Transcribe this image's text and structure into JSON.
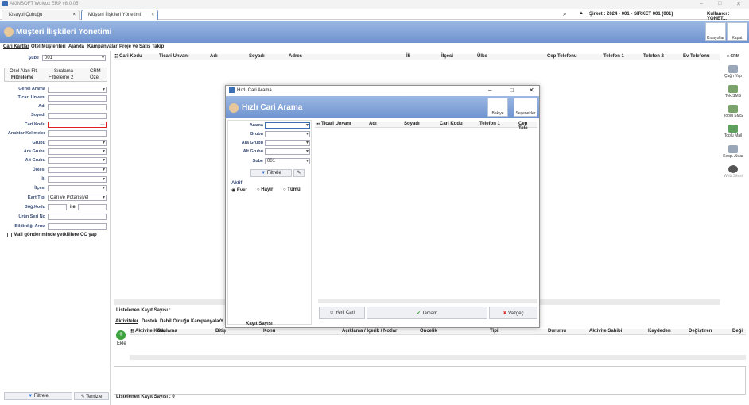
{
  "window": {
    "title": "AKINSOFT Wolvox ERP v8.0.05",
    "buttons": {
      "minimize": "–",
      "maximize": "□",
      "close": "✕"
    }
  },
  "tabs": [
    {
      "label": "Kısayol Çubuğu"
    },
    {
      "label": "Müşteri İlişkileri Yönetimi"
    }
  ],
  "status": {
    "company": "Şirket : 2024 - 001 - SIRKET 001 (001)",
    "user": "Kullanıcı : YONET..."
  },
  "banner": {
    "title": "Müşteri İlişkileri Yönetimi",
    "buttons": [
      {
        "label": "Kısayollar"
      },
      {
        "label": "Kapat"
      }
    ]
  },
  "menu": [
    "Cari Kartlar",
    "Otel Müşterileri",
    "Ajanda",
    "Kampanyalar",
    "Proje ve Satış Takip"
  ],
  "filter": {
    "sube_label": "Şube",
    "sube_value": "001",
    "tabs_row1": [
      "Özel Alan Flt.",
      "Sıralama",
      "CRM"
    ],
    "tabs_row2": [
      "Filtreleme",
      "Filtreleme 2",
      "Özel"
    ],
    "fields": [
      "Genel Arama",
      "Ticari Unvanı",
      "Adı",
      "Soyadı",
      "Cari Kodu",
      "Anahtar Kelimeler",
      "Grubu",
      "Ara Grubu",
      "Alt Grubu",
      "Ülkesi",
      "İli",
      "İlçesi",
      "Kart Tipi",
      "Böğ.Kodu",
      "Ürün Seri No",
      "Bildirdiği Arıza"
    ],
    "kart_tipi_value": "Cari ve Potansiyel",
    "bog_ile": "ile",
    "checkbox": "Mail gönderiminde yetkililere CC yap",
    "buttons": {
      "filter": "Filtrele",
      "clear": "Temizle"
    }
  },
  "main_grid": {
    "columns": [
      "Cari Kodu",
      "Ticari Unvanı",
      "Adı",
      "Soyadı",
      "Adres",
      "İli",
      "İlçesi",
      "Ülke",
      "Cep Telefonu",
      "Telefon 1",
      "Telefon 2",
      "Ev Telefonu"
    ],
    "footer": "Listelenen Kayıt Sayısı :"
  },
  "right_tools": [
    {
      "label": "e-CRM"
    },
    {
      "label": "Çağrı Yap"
    },
    {
      "label": "Tek SMS"
    },
    {
      "label": "Toplu SMS"
    },
    {
      "label": "Toplu Mail"
    },
    {
      "label": "Kesp. Aktar"
    },
    {
      "label": "Web Sitesi"
    }
  ],
  "lower": {
    "tabs": [
      "Aktiviteler",
      "Destek",
      "Dahil Olduğu Kampanyalar",
      "Y"
    ],
    "add": "Ekle",
    "columns": [
      "Aktivite Kodu",
      "Başlama",
      "Bitiş",
      "Konu",
      "Açıklama / İçerik / Notlar",
      "Öncelik",
      "Tipi",
      "Durumu",
      "Aktivite Sahibi",
      "Kaydeden",
      "Değiştiren",
      "Deği"
    ],
    "footer": "Listelenen Kayıt Sayısı : 0"
  },
  "dialog": {
    "title": "Hızlı Cari Arama",
    "header": "Hızlı Cari Arama",
    "buttons_top": [
      {
        "label": "Bakiye"
      },
      {
        "label": "Seçenekler"
      }
    ],
    "fields": [
      "Arama",
      "Grubu",
      "Ara Grubu",
      "Alt Grubu",
      "Şube"
    ],
    "sube_value": "001",
    "filter_btn": "Filtrele",
    "aktif": {
      "label": "Aktif",
      "options": [
        "Evet",
        "Hayır",
        "Tümü"
      ],
      "selected": "Evet"
    },
    "columns": [
      "Ticari Unvanı",
      "Adı",
      "Soyadı",
      "Cari Kodu",
      "Telefon 1",
      "Cep Tele"
    ],
    "buttons_bottom": {
      "new": "Yeni Cari",
      "ok": "Tamam",
      "cancel": "Vazgeç"
    },
    "footer": "Kayıt Sayısı"
  },
  "colors": {
    "accent": "#6e93cf",
    "highlight": "#e02020"
  }
}
